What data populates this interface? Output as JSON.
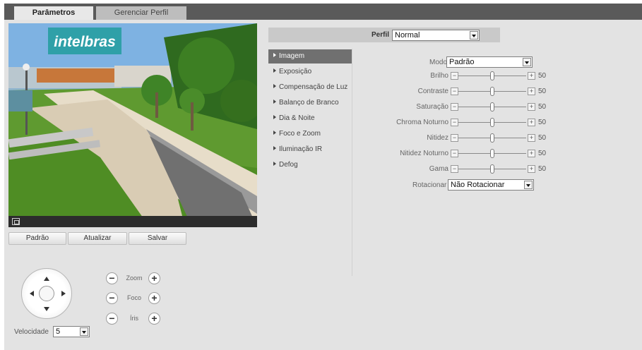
{
  "tabs": [
    {
      "label": "Parâmetros",
      "active": true
    },
    {
      "label": "Gerenciar Perfil",
      "active": false
    }
  ],
  "video": {
    "logo_text": "intelbras",
    "fullscreen_icon": "fullscreen-icon"
  },
  "buttons": {
    "default": "Padrão",
    "refresh": "Atualizar",
    "save": "Salvar"
  },
  "ptz": {
    "zoom": "Zoom",
    "focus": "Foco",
    "iris": "Íris",
    "speed_label": "Velocidade",
    "speed_value": "5",
    "minus": "−",
    "plus": "+"
  },
  "profile": {
    "label": "Perfil",
    "value": "Normal"
  },
  "menu": [
    {
      "label": "Imagem",
      "active": true
    },
    {
      "label": "Exposição",
      "active": false
    },
    {
      "label": "Compensação de Luz",
      "active": false
    },
    {
      "label": "Balanço de Branco",
      "active": false
    },
    {
      "label": "Dia & Noite",
      "active": false
    },
    {
      "label": "Foco e Zoom",
      "active": false
    },
    {
      "label": "Iluminação IR",
      "active": false
    },
    {
      "label": "Defog",
      "active": false
    }
  ],
  "settings": {
    "mode_label": "Modo",
    "mode_value": "Padrão",
    "sliders": [
      {
        "label": "Brilho",
        "value": "50",
        "level": 0.5
      },
      {
        "label": "Contraste",
        "value": "50",
        "level": 0.5
      },
      {
        "label": "Saturação",
        "value": "50",
        "level": 0.5
      },
      {
        "label": "Chroma Noturno",
        "value": "50",
        "level": 0.5
      },
      {
        "label": "Nitidez",
        "value": "50",
        "level": 0.5
      },
      {
        "label": "Nitidez Noturno",
        "value": "50",
        "level": 0.5
      },
      {
        "label": "Gama",
        "value": "50",
        "level": 0.5
      }
    ],
    "rotate_label": "Rotacionar",
    "rotate_value": "Não Rotacionar",
    "minus_symbol": "−",
    "plus_symbol": "+"
  },
  "colors": {
    "active_menu": "#707070",
    "tabbar": "#5a5a5a",
    "panel": "#e3e3e3"
  }
}
